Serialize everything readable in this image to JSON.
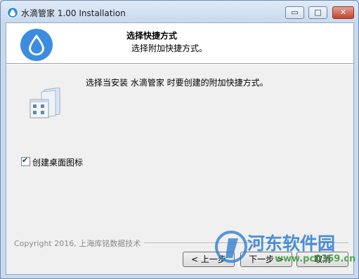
{
  "window": {
    "title": "水滴管家 1.00 Installation",
    "min_glyph": "▭",
    "max_glyph": "□",
    "close_glyph": "✕",
    "icon": "water-drop-icon"
  },
  "header": {
    "title": "选择快捷方式",
    "subtitle": "选择附加快捷方式。",
    "icon": "water-drop-icon"
  },
  "body": {
    "instruction": "选择当安装 水滴管家 时要创建的附加快捷方式。",
    "graphic_icon": "shortcut-graphic-icon",
    "desktop_shortcut": {
      "label": "创建桌面图标",
      "checked": true,
      "check_glyph": "✔"
    }
  },
  "footer": {
    "copyright": "Copyright 2016, 上海库铭数据技术",
    "back_label": "< 上一步",
    "next_label": "下一步 >",
    "cancel_label": "取消"
  },
  "watermark": {
    "text": "河东软件园",
    "url": "www.pc0359.cn"
  },
  "colors": {
    "accent": "#3c8de0",
    "window_frame": "#c8daef",
    "close_button": "#c0432c"
  }
}
